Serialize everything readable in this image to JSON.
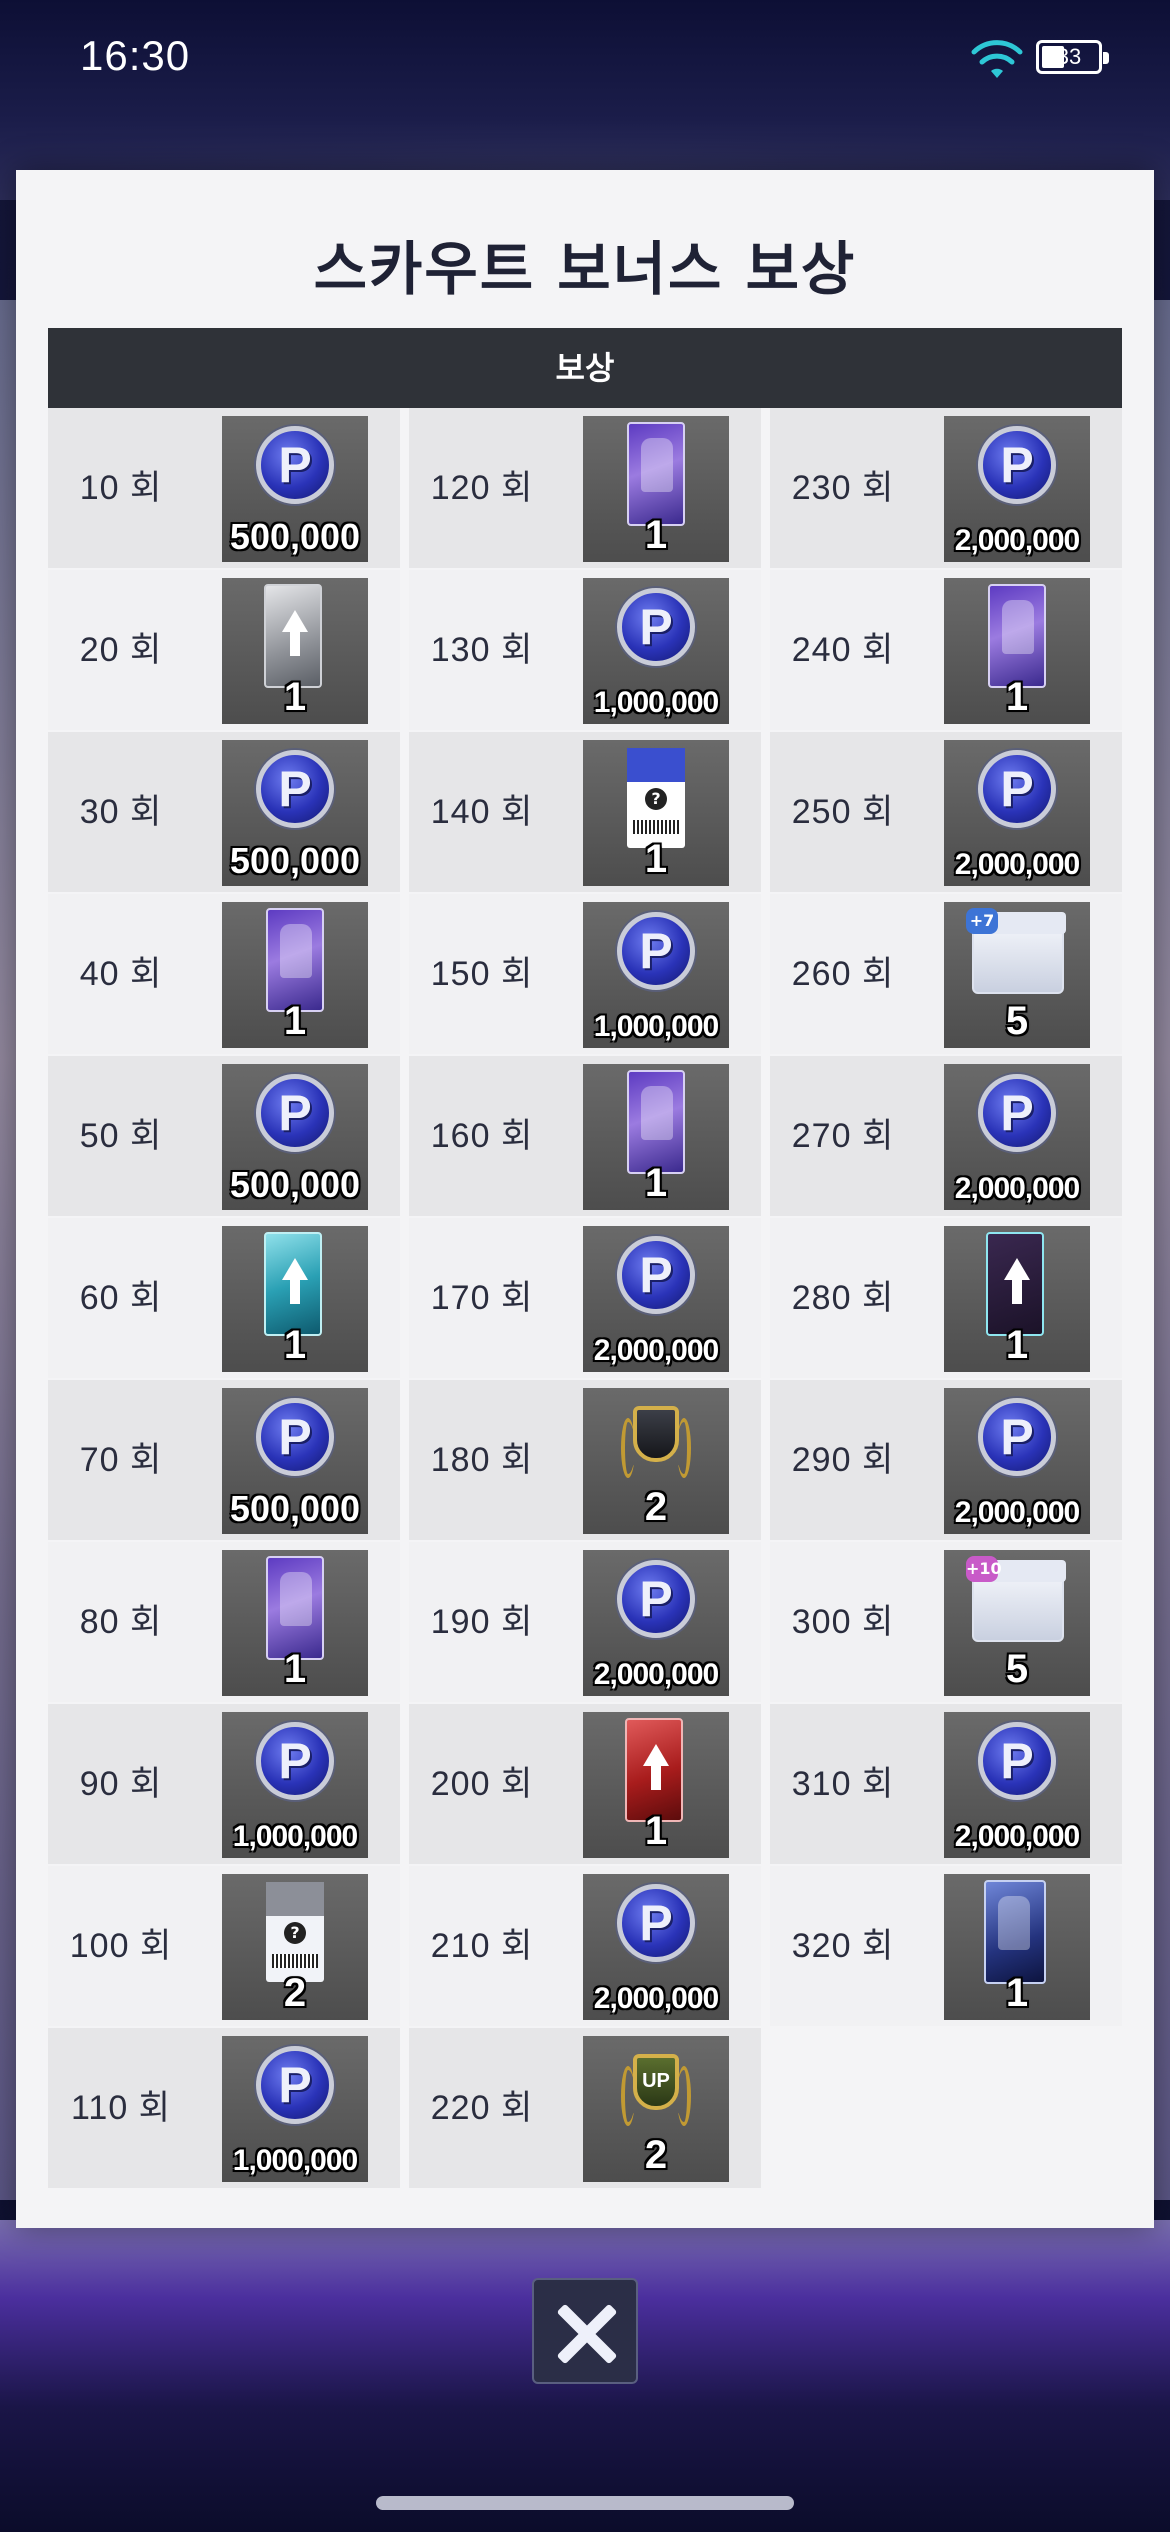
{
  "status_bar": {
    "time": "16:30",
    "battery": "33"
  },
  "modal": {
    "title": "스카우트 보너스 보상",
    "header": "보상"
  },
  "columns": [
    [
      {
        "label": "10 회",
        "type": "coin",
        "count": "500,000"
      },
      {
        "label": "20 회",
        "type": "card-silver",
        "count": "1"
      },
      {
        "label": "30 회",
        "type": "coin",
        "count": "500,000"
      },
      {
        "label": "40 회",
        "type": "card-purple",
        "count": "1"
      },
      {
        "label": "50 회",
        "type": "coin",
        "count": "500,000"
      },
      {
        "label": "60 회",
        "type": "card-teal",
        "count": "1"
      },
      {
        "label": "70 회",
        "type": "coin",
        "count": "500,000"
      },
      {
        "label": "80 회",
        "type": "card-purple",
        "count": "1"
      },
      {
        "label": "90 회",
        "type": "coin",
        "count": "1,000,000"
      },
      {
        "label": "100 회",
        "type": "ticket-grey",
        "count": "2"
      },
      {
        "label": "110 회",
        "type": "coin",
        "count": "1,000,000"
      }
    ],
    [
      {
        "label": "120 회",
        "type": "card-purple",
        "count": "1"
      },
      {
        "label": "130 회",
        "type": "coin",
        "count": "1,000,000"
      },
      {
        "label": "140 회",
        "type": "ticket-blue",
        "count": "1"
      },
      {
        "label": "150 회",
        "type": "coin",
        "count": "1,000,000"
      },
      {
        "label": "160 회",
        "type": "card-purple",
        "count": "1"
      },
      {
        "label": "170 회",
        "type": "coin",
        "count": "2,000,000"
      },
      {
        "label": "180 회",
        "type": "emblem-gold",
        "count": "2"
      },
      {
        "label": "190 회",
        "type": "coin",
        "count": "2,000,000"
      },
      {
        "label": "200 회",
        "type": "card-red",
        "count": "1"
      },
      {
        "label": "210 회",
        "type": "coin",
        "count": "2,000,000"
      },
      {
        "label": "220 회",
        "type": "emblem-green",
        "count": "2"
      }
    ],
    [
      {
        "label": "230 회",
        "type": "coin",
        "count": "2,000,000"
      },
      {
        "label": "240 회",
        "type": "card-purple",
        "count": "1"
      },
      {
        "label": "250 회",
        "type": "coin",
        "count": "2,000,000"
      },
      {
        "label": "260 회",
        "type": "box-blue",
        "count": "5"
      },
      {
        "label": "270 회",
        "type": "coin",
        "count": "2,000,000"
      },
      {
        "label": "280 회",
        "type": "card-dark",
        "count": "1"
      },
      {
        "label": "290 회",
        "type": "coin",
        "count": "2,000,000"
      },
      {
        "label": "300 회",
        "type": "box-pink",
        "count": "5"
      },
      {
        "label": "310 회",
        "type": "coin",
        "count": "2,000,000"
      },
      {
        "label": "320 회",
        "type": "card-blue",
        "count": "1"
      }
    ]
  ],
  "icon_text": {
    "coin_letter": "P",
    "box_blue_badge": "+7",
    "box_pink_badge": "+10",
    "ticket_question": "?",
    "emblem_green_text": "UP"
  },
  "colors": {
    "header_bg": "#2f3238",
    "coin_blue": "#2a33b8",
    "modal_bg": "#f4f4f6"
  }
}
